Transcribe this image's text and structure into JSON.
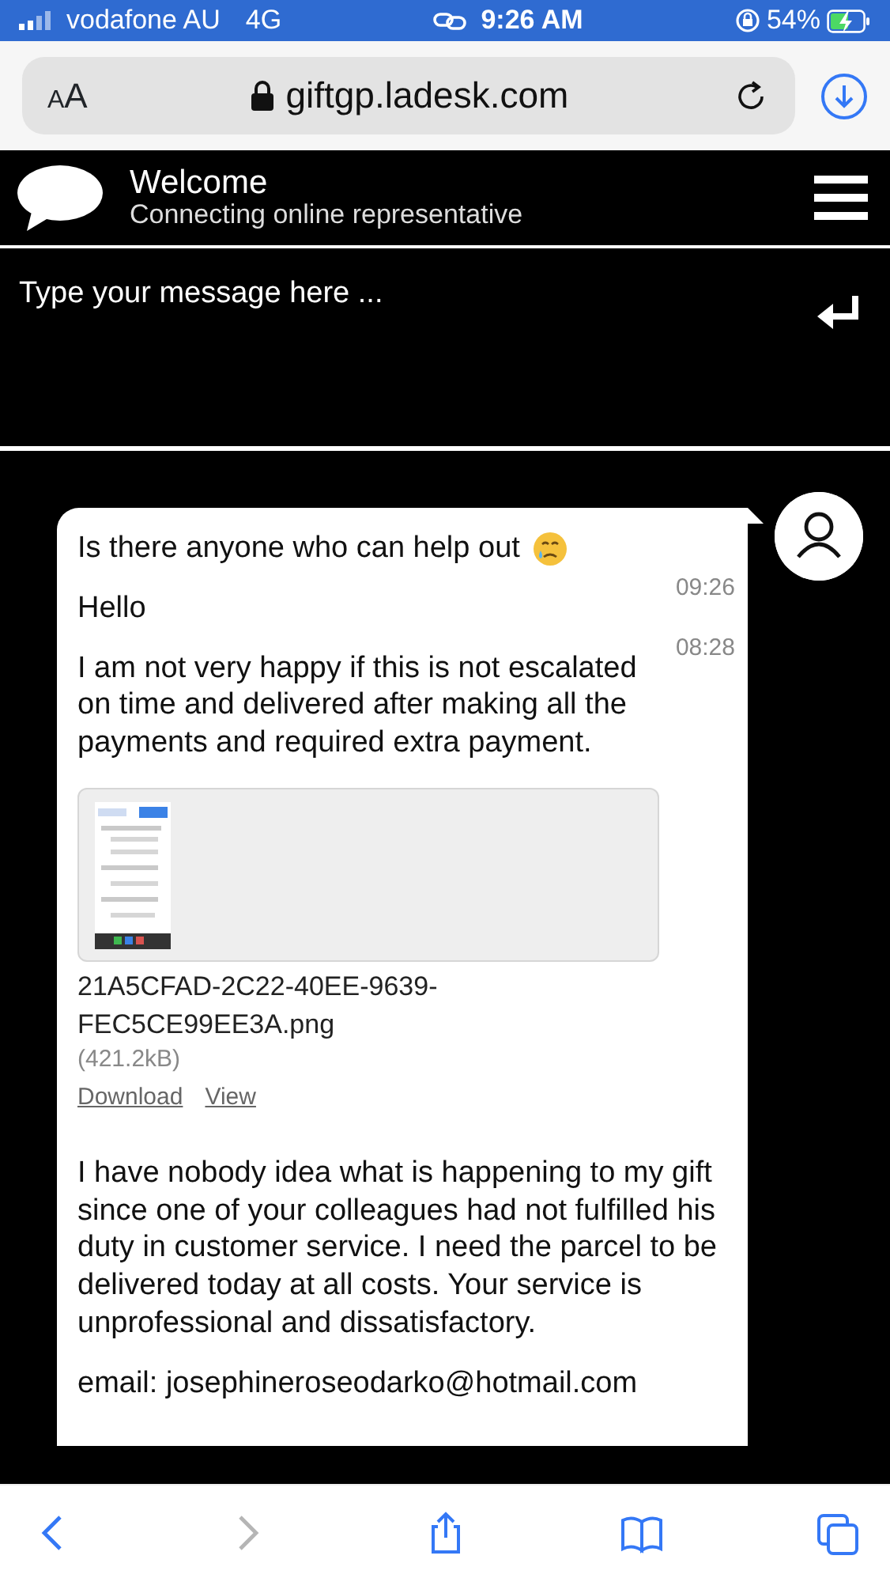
{
  "status_bar": {
    "carrier": "vodafone AU",
    "network": "4G",
    "time": "9:26 AM",
    "battery": "54%",
    "charging": true
  },
  "browser": {
    "text_size": "AA",
    "url": "giftgp.ladesk.com"
  },
  "chat_header": {
    "title": "Welcome",
    "subtitle": "Connecting online representative"
  },
  "composer": {
    "placeholder": "Type your message here ..."
  },
  "messages": [
    {
      "kind": "emoji",
      "text": "Is there anyone who can help out"
    },
    {
      "kind": "text",
      "text": "Hello",
      "time": "09:26"
    },
    {
      "kind": "text",
      "text": "I am not very happy if this is not escalated on time and delivered after making all the payments and required extra payment.",
      "time": "08:28"
    },
    {
      "kind": "attachment",
      "filename": "21A5CFAD-2C22-40EE-9639-FEC5CE99EE3A.png",
      "size": "(421.2kB)",
      "links": [
        "Download",
        "View"
      ]
    },
    {
      "kind": "text",
      "text": "I have nobody idea what is happening to my gift since one of your colleagues had not fulfilled his duty in customer service. I need the parcel to be delivered today at all costs. Your service is unprofessional and dissatisfactory."
    },
    {
      "kind": "text",
      "text": "email: josephineroseodarko@hotmail.com"
    }
  ],
  "toolbar": [
    {
      "kind": "back",
      "disabled": false
    },
    {
      "kind": "forward",
      "disabled": true
    },
    {
      "kind": "share",
      "disabled": false
    },
    {
      "kind": "bookmarks",
      "disabled": false
    },
    {
      "kind": "tabs",
      "disabled": false
    }
  ]
}
